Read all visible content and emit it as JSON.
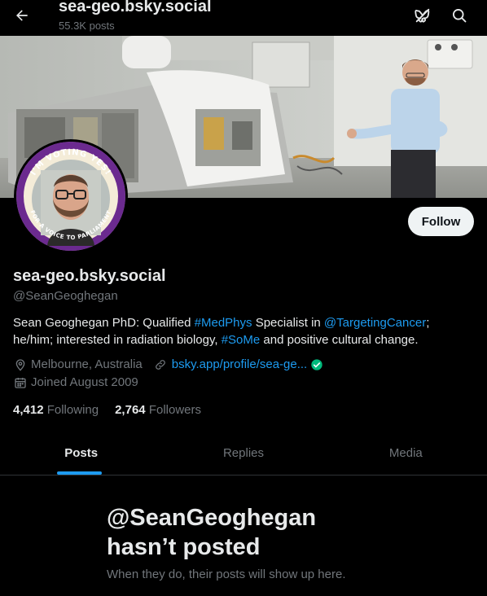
{
  "header": {
    "title": "sea-geo.bsky.social",
    "post_count": "55.3K posts",
    "back_icon": "arrow-left-icon",
    "bluesky_icon": "butterfly-slash-icon",
    "search_icon": "search-icon"
  },
  "avatar": {
    "badge_top": "I'M VOTING YES!",
    "badge_bottom": "FOR A VOICE TO PARLIAMENT"
  },
  "profile": {
    "follow_label": "Follow",
    "display_name": "sea-geo.bsky.social",
    "handle": "@SeanGeoghegan",
    "bio": {
      "p1": "Sean Geoghegan PhD: Qualified ",
      "tag1": "#MedPhys",
      "p2": " Specialist in ",
      "mention": "@TargetingCancer",
      "p3": ";",
      "p4": "he/him; interested in radiation biology, ",
      "tag2": "#SoMe",
      "p5": " and positive cultural change."
    },
    "location": "Melbourne, Australia",
    "website": "bsky.app/profile/sea-ge...",
    "joined": "Joined August 2009",
    "following_count": "4,412",
    "following_label": "Following",
    "followers_count": "2,764",
    "followers_label": "Followers"
  },
  "tabs": [
    {
      "label": "Posts",
      "active": true
    },
    {
      "label": "Replies",
      "active": false
    },
    {
      "label": "Media",
      "active": false
    }
  ],
  "empty_state": {
    "title_line1": "@SeanGeoghegan",
    "title_line2": "hasn’t posted",
    "subtitle": "When they do, their posts will show up here."
  },
  "colors": {
    "accent": "#1d9bf0",
    "background": "#000000",
    "text_primary": "#e7e9ea",
    "text_secondary": "#71767b",
    "verified": "#00ba7c",
    "badge_purple": "#6b2a8f"
  }
}
